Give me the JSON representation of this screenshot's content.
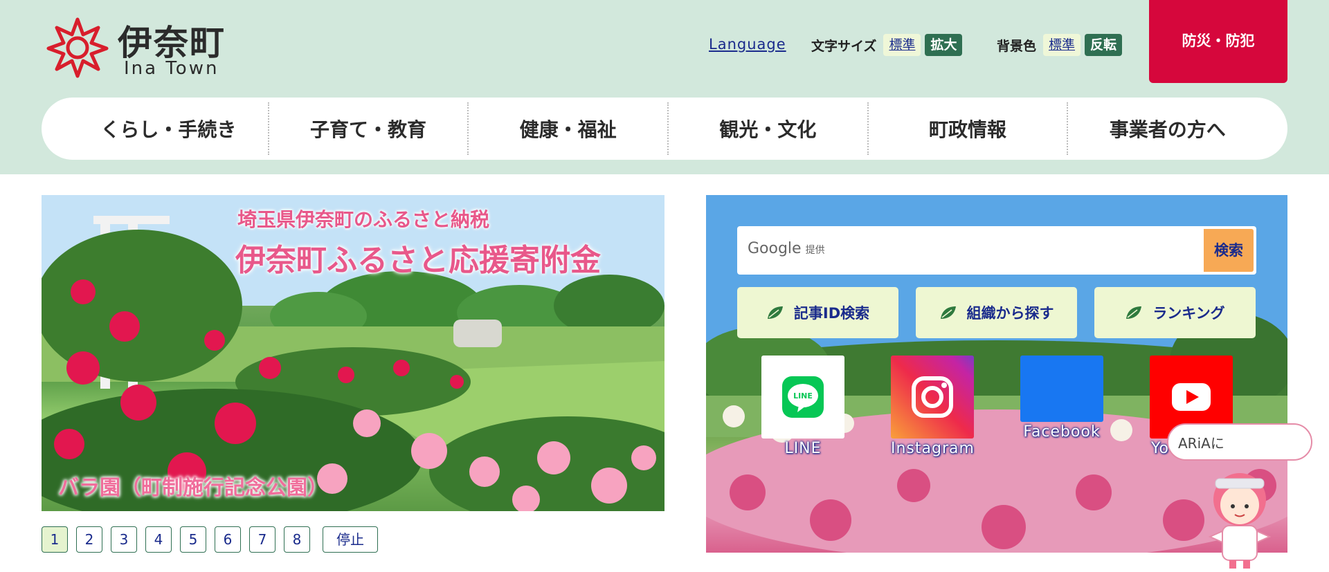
{
  "site": {
    "title": "伊奈町",
    "subtitle": "Ina Town"
  },
  "utility": {
    "language": "Language",
    "font_size_label": "文字サイズ",
    "font_standard": "標準",
    "font_large": "拡大",
    "bg_label": "背景色",
    "bg_standard": "標準",
    "bg_invert": "反転",
    "disaster": "防災・防犯"
  },
  "nav": {
    "items": [
      "くらし・手続き",
      "子育て・教育",
      "健康・福祉",
      "観光・文化",
      "町政情報",
      "事業者の方へ"
    ]
  },
  "slider": {
    "subtitle": "埼玉県伊奈町のふるさと納税",
    "title": "伊奈町ふるさと応援寄附金",
    "caption": "バラ園（町制施行記念公園）",
    "pages": [
      "1",
      "2",
      "3",
      "4",
      "5",
      "6",
      "7",
      "8"
    ],
    "active_page": 1,
    "stop_label": "停止"
  },
  "search": {
    "provider": "Google",
    "provider_suffix": "提供",
    "button": "検索"
  },
  "quick_links": [
    "記事ID検索",
    "組織から探す",
    "ランキング"
  ],
  "sns": [
    {
      "label": "LINE",
      "icon": "line-icon"
    },
    {
      "label": "Instagram",
      "icon": "instagram-icon"
    },
    {
      "label": "Facebook",
      "icon": "facebook-icon"
    },
    {
      "label": "Yo",
      "icon": "youtube-icon"
    }
  ],
  "aria": {
    "bubble": "ARiAに"
  },
  "colors": {
    "header_bg": "#d2e8dc",
    "accent_green": "#2f6f52",
    "disaster_red": "#d6073c",
    "link_blue": "#1a2b8c",
    "search_orange": "#f7a955",
    "quick_bg": "#eef7d2"
  }
}
